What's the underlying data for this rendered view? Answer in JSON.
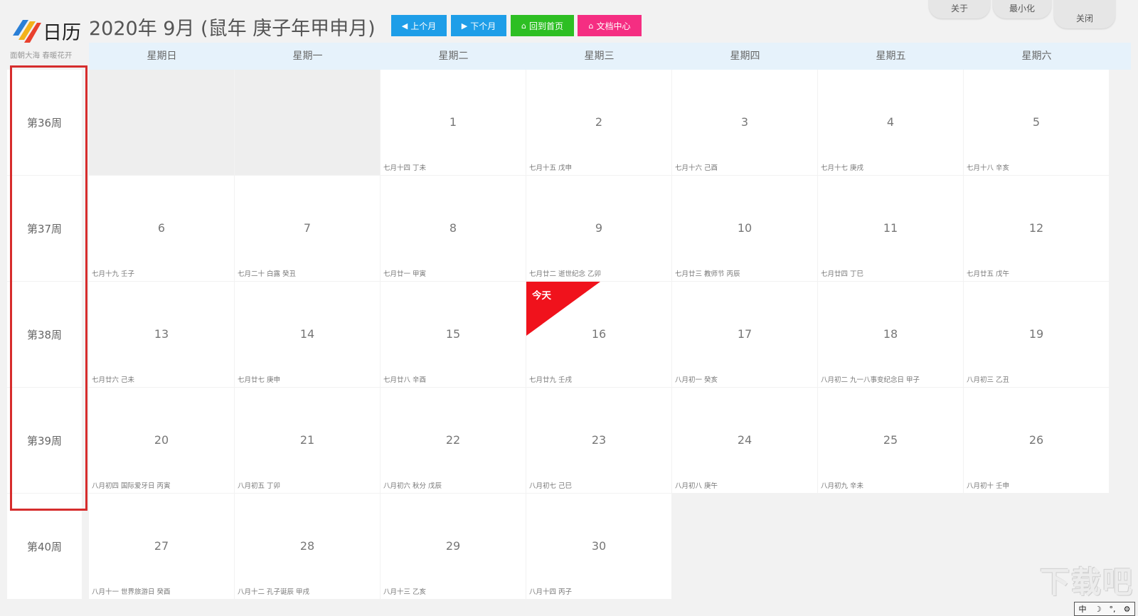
{
  "app": {
    "logo_text": "日历",
    "logo_sub": "面朝大海  春暖花开",
    "title": "2020年 9月 (鼠年 庚子年甲申月)"
  },
  "toolbar": {
    "prev_label": "上个月",
    "next_label": "下个月",
    "home_label": "回到首页",
    "docs_label": "文档中心",
    "colors": {
      "prev": "#1e9ee8",
      "next": "#1e9ee8",
      "home": "#2dbf23",
      "docs": "#f52e82"
    }
  },
  "window": {
    "about": "关于",
    "minimize": "最小化",
    "close": "关闭"
  },
  "weekdays": [
    "星期日",
    "星期一",
    "星期二",
    "星期三",
    "星期四",
    "星期五",
    "星期六"
  ],
  "weeks": [
    "第36周",
    "第37周",
    "第38周",
    "第39周",
    "第40周"
  ],
  "today_label": "今天",
  "today_color": "#f0121c",
  "highlight_color": "#d62d2d",
  "days": [
    {
      "day": "1",
      "lunar": "七月十四   丁未"
    },
    {
      "day": "2",
      "lunar": "七月十五   戊申"
    },
    {
      "day": "3",
      "lunar": "七月十六   己酉"
    },
    {
      "day": "4",
      "lunar": "七月十七   庚戌"
    },
    {
      "day": "5",
      "lunar": "七月十八   辛亥"
    },
    {
      "day": "6",
      "lunar": "七月十九   壬子"
    },
    {
      "day": "7",
      "lunar": "七月二十 白露  癸丑"
    },
    {
      "day": "8",
      "lunar": "七月廿一   甲寅"
    },
    {
      "day": "9",
      "lunar": "七月廿二    逝世纪念 乙卯"
    },
    {
      "day": "10",
      "lunar": "七月廿三  教师节 丙辰"
    },
    {
      "day": "11",
      "lunar": "七月廿四   丁巳"
    },
    {
      "day": "12",
      "lunar": "七月廿五   戊午"
    },
    {
      "day": "13",
      "lunar": "七月廿六   己未"
    },
    {
      "day": "14",
      "lunar": "七月廿七   庚申"
    },
    {
      "day": "15",
      "lunar": "七月廿八   辛酉"
    },
    {
      "day": "16",
      "lunar": "七月廿九   壬戌"
    },
    {
      "day": "17",
      "lunar": "八月初一   癸亥"
    },
    {
      "day": "18",
      "lunar": "八月初二  九一八事变纪念日 甲子"
    },
    {
      "day": "19",
      "lunar": "八月初三   乙丑"
    },
    {
      "day": "20",
      "lunar": "八月初四  国际爱牙日 丙寅"
    },
    {
      "day": "21",
      "lunar": "八月初五   丁卯"
    },
    {
      "day": "22",
      "lunar": "八月初六 秋分  戊辰"
    },
    {
      "day": "23",
      "lunar": "八月初七   己巳"
    },
    {
      "day": "24",
      "lunar": "八月初八   庚午"
    },
    {
      "day": "25",
      "lunar": "八月初九   辛未"
    },
    {
      "day": "26",
      "lunar": "八月初十   壬申"
    },
    {
      "day": "27",
      "lunar": "八月十一  世界旅游日 癸酉"
    },
    {
      "day": "28",
      "lunar": "八月十二  孔子诞辰 甲戌"
    },
    {
      "day": "29",
      "lunar": "八月十三   乙亥"
    },
    {
      "day": "30",
      "lunar": "八月十四   丙子"
    }
  ],
  "watermark": "下载吧",
  "ime": [
    "中",
    "☽",
    "°,",
    "⚙"
  ]
}
